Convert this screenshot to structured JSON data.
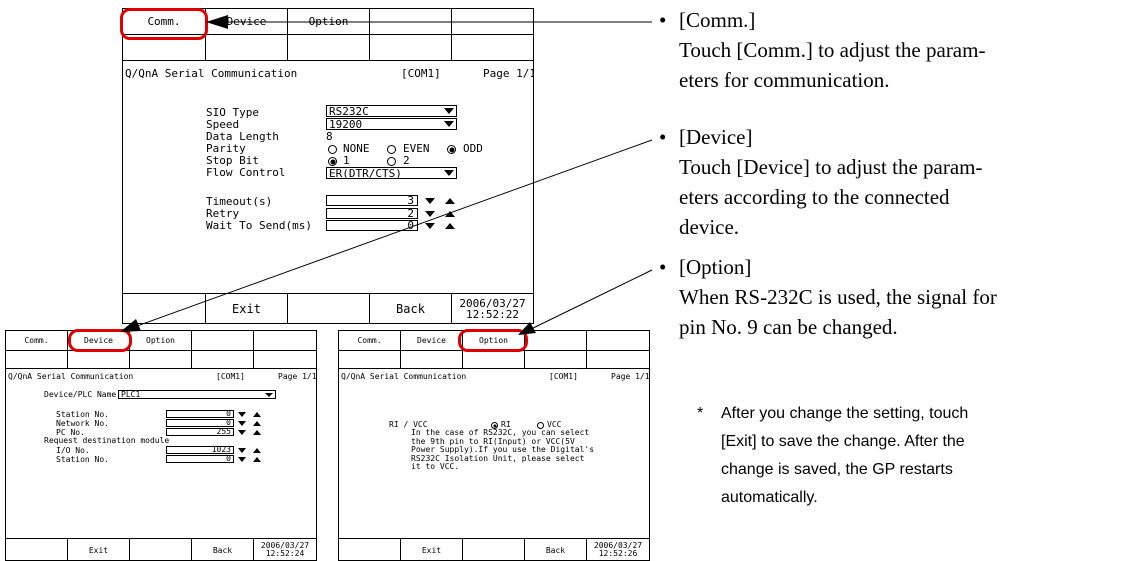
{
  "main_screen": {
    "tabs": [
      "Comm.",
      "Device",
      "Option"
    ],
    "title": "Q/QnA Serial Communication",
    "port": "[COM1]",
    "page": "Page 1/1",
    "labels": {
      "sio": "SIO Type",
      "speed": "Speed",
      "data_length": "Data Length",
      "parity": "Parity",
      "stop_bit": "Stop Bit",
      "flow": "Flow Control",
      "timeout": "Timeout(s)",
      "retry": "Retry",
      "wait": "Wait To Send(ms)"
    },
    "values": {
      "sio": "RS232C",
      "speed": "19200",
      "data_length": "8",
      "parity_none": "NONE",
      "parity_even": "EVEN",
      "parity_odd": "ODD",
      "parity_selected": "ODD",
      "stop_1": "1",
      "stop_2": "2",
      "stop_selected": "1",
      "flow": "ER(DTR/CTS)",
      "timeout": "3",
      "retry": "2",
      "wait": "0"
    },
    "footer": {
      "exit": "Exit",
      "back": "Back",
      "date": "2006/03/27",
      "time": "12:52:22"
    }
  },
  "device_screen": {
    "tabs": [
      "Comm.",
      "Device",
      "Option"
    ],
    "title": "Q/QnA Serial Communication",
    "port": "[COM1]",
    "page": "Page 1/1",
    "device_label": "Device/PLC Name",
    "device_value": "PLC1",
    "labels": {
      "station": "Station No.",
      "network": "Network No.",
      "pc": "PC No.",
      "request": "Request destination module",
      "io": "I/O No.",
      "station2": "Station No."
    },
    "values": {
      "station": "0",
      "network": "0",
      "pc": "255",
      "io": "1023",
      "station2": "0"
    },
    "footer": {
      "exit": "Exit",
      "back": "Back",
      "date": "2006/03/27",
      "time": "12:52:24"
    }
  },
  "option_screen": {
    "tabs": [
      "Comm.",
      "Device",
      "Option"
    ],
    "title": "Q/QnA Serial Communication",
    "port": "[COM1]",
    "page": "Page 1/1",
    "ri_label": "RI / VCC",
    "ri_option": "RI",
    "vcc_option": "VCC",
    "ri_selected": "RI",
    "description": "In the case of RS232C, you can select\nthe 9th pin to RI(Input) or VCC(5V\nPower Supply).If you use the Digital's\nRS232C Isolation Unit, please select\nit to VCC.",
    "footer": {
      "exit": "Exit",
      "back": "Back",
      "date": "2006/03/27",
      "time": "12:52:26"
    }
  },
  "annotations": {
    "comm": {
      "bullet": "•",
      "title": "[Comm.]",
      "text": "Touch [Comm.] to adjust the param-\neters for communication."
    },
    "device": {
      "bullet": "•",
      "title": "[Device]",
      "text": "Touch [Device] to adjust the param-\neters according to the connected\ndevice."
    },
    "option": {
      "bullet": "•",
      "title": "[Option]",
      "text": "When RS-232C is used, the signal for\npin No. 9 can be changed."
    },
    "note": {
      "mark": "*",
      "text": "After you change the setting, touch\n[Exit] to save the change. After the\nchange is saved, the GP restarts\nautomatically."
    }
  },
  "colors": {
    "highlight": "#e00000",
    "line": "#000000"
  }
}
